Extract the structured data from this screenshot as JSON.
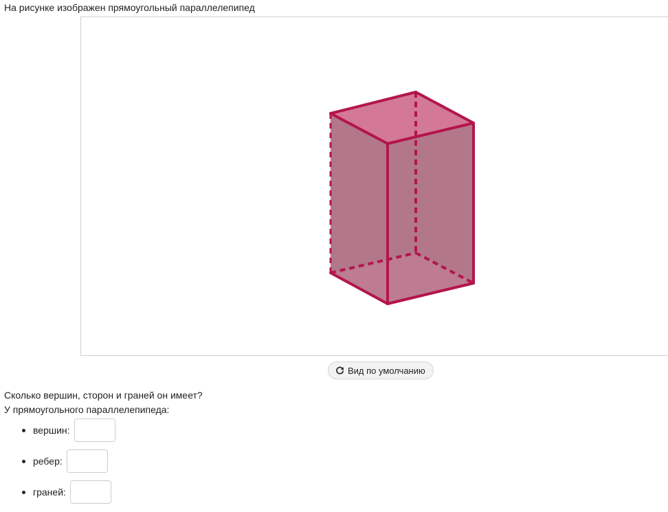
{
  "intro_text": "На рисунке изображен прямоугольный параллелепипед",
  "viewer": {
    "face_color": "#b2788a",
    "top_color": "#d37896",
    "edge_color": "#b3154d"
  },
  "reset_button": {
    "label": "Вид по умолчанию",
    "icon": "refresh-icon"
  },
  "question": {
    "line1": "Сколько вершин, сторон и граней он имеет?",
    "line2": "У прямоугольного параллелепипеда:"
  },
  "answers": [
    {
      "label": "вершин:",
      "value": ""
    },
    {
      "label": "ребер:",
      "value": ""
    },
    {
      "label": "граней:",
      "value": ""
    }
  ]
}
